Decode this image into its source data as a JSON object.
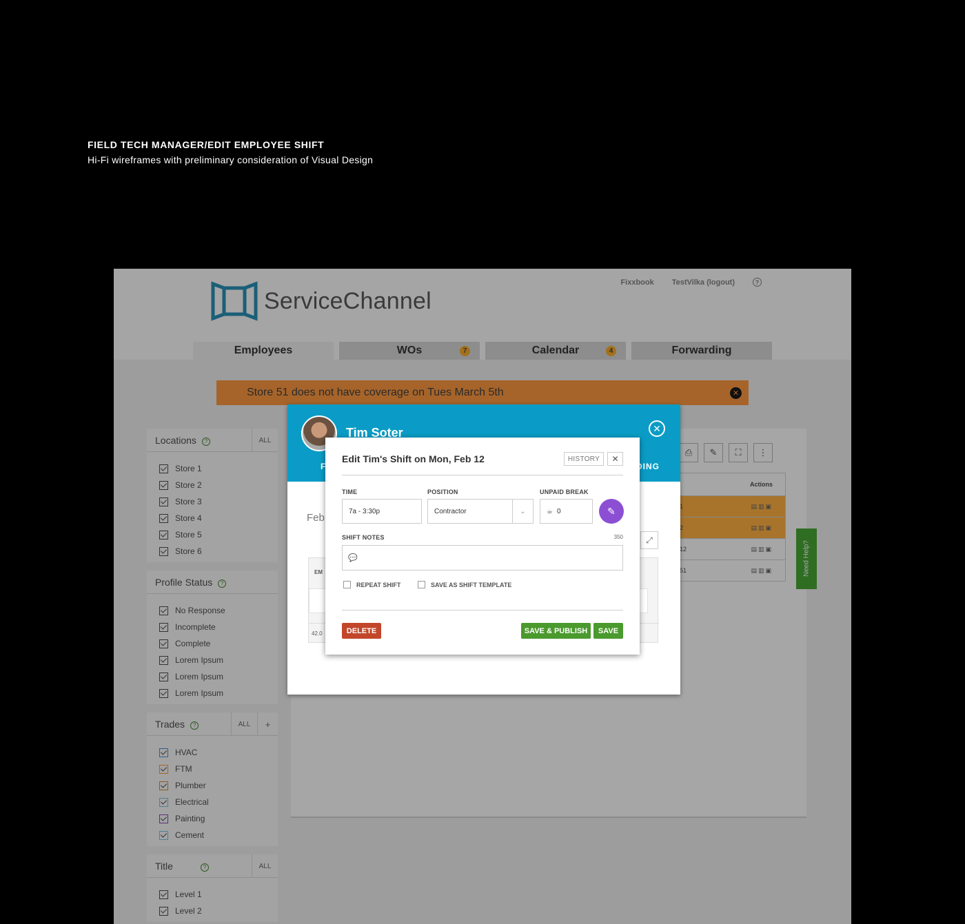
{
  "caption": {
    "title": "FIELD TECH MANAGER/EDIT EMPLOYEE SHIFT",
    "subtitle": "Hi-Fi wireframes with preliminary consideration of Visual Design"
  },
  "brand": {
    "name": "ServiceChannel",
    "accent": "#0a9cc6"
  },
  "toplinks": {
    "fixxbook": "Fixxbook",
    "user": "TestVilka (logout)",
    "help": "?"
  },
  "tabs": [
    {
      "label": "Employees",
      "badge": ""
    },
    {
      "label": "WOs",
      "badge": "7"
    },
    {
      "label": "Calendar",
      "badge": "4"
    },
    {
      "label": "Forwarding",
      "badge": ""
    }
  ],
  "alert": {
    "text": "Store 51 does not have coverage on Tues March 5th",
    "close": "✕"
  },
  "sidebar": {
    "locations": {
      "title": "Locations",
      "all": "ALL",
      "items": [
        "Store 1",
        "Store 2",
        "Store 3",
        "Store 4",
        "Store 5",
        "Store 6"
      ]
    },
    "profile_status": {
      "title": "Profile Status",
      "items": [
        "No Response",
        "Incomplete",
        "Complete",
        "Lorem Ipsum",
        "Lorem Ipsum",
        "Lorem Ipsum"
      ]
    },
    "trades": {
      "title": "Trades",
      "all": "ALL",
      "add": "+",
      "items": [
        {
          "label": "HVAC",
          "color": "#2d5f8a"
        },
        {
          "label": "FTM",
          "color": "#a4681f"
        },
        {
          "label": "Plumber",
          "color": "#8a5a2a"
        },
        {
          "label": "Electrical",
          "color": "#4f7f94"
        },
        {
          "label": "Painting",
          "color": "#5b2f7a"
        },
        {
          "label": "Cement",
          "color": "#4f7f94"
        }
      ]
    },
    "title_panel": {
      "title": "Title",
      "all": "ALL",
      "items": [
        "Level 1",
        "Level 2"
      ]
    }
  },
  "background_table": {
    "header": "Actions",
    "rows": [
      {
        "id": "1",
        "highlight": true
      },
      {
        "id": "2",
        "highlight": true
      },
      {
        "id": "12",
        "highlight": false
      },
      {
        "id": "51",
        "highlight": false
      }
    ]
  },
  "need_help": "Need Help?",
  "employee_modal": {
    "name": "Tim Soter",
    "tab_left": "F",
    "tab_right": "DING",
    "date": "Feb",
    "box_label": "EM",
    "box_footer": "42.0"
  },
  "dialog": {
    "title": "Edit Tim's Shift on Mon, Feb 12",
    "history": "HISTORY",
    "close": "✕",
    "time_label": "TIME",
    "time_value": "7a - 3:30p",
    "position_label": "POSITION",
    "position_value": "Contractor",
    "break_label": "UNPAID BREAK",
    "break_value": "0",
    "notes_label": "SHIFT NOTES",
    "notes_count": "350",
    "repeat_label": "REPEAT SHIFT",
    "template_label": "SAVE AS SHIFT TEMPLATE",
    "delete_label": "DELETE",
    "save_publish_label": "SAVE & PUBLISH",
    "save_label": "SAVE"
  }
}
